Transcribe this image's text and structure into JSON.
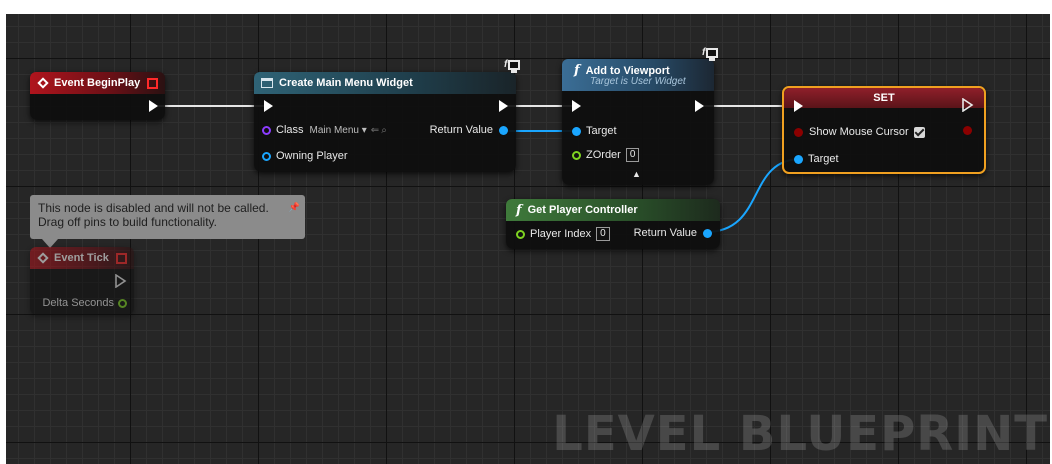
{
  "graph": {
    "watermark": "LEVEL BLUEPRINT"
  },
  "event_beginplay": {
    "title": "Event BeginPlay"
  },
  "create_widget": {
    "title": "Create Main Menu Widget",
    "class_label": "Class",
    "class_value": "Main Menu",
    "owning_player_label": "Owning Player",
    "return_value_label": "Return Value"
  },
  "add_to_viewport": {
    "title": "Add to Viewport",
    "subtitle": "Target is User Widget",
    "target_label": "Target",
    "zorder_label": "ZOrder",
    "zorder_value": "0"
  },
  "set_node": {
    "title": "SET",
    "show_mouse_cursor_label": "Show Mouse Cursor",
    "target_label": "Target"
  },
  "get_player_controller": {
    "title": "Get Player Controller",
    "player_index_label": "Player Index",
    "player_index_value": "0",
    "return_value_label": "Return Value"
  },
  "comment": {
    "line1": "This node is disabled and will not be called.",
    "line2": "Drag off pins to build functionality."
  },
  "event_tick": {
    "title": "Event Tick",
    "delta_seconds_label": "Delta Seconds"
  },
  "colors": {
    "graph_bg": "#262626",
    "object_pin": "#1aa6ff",
    "float_pin": "#7ed321",
    "selection": "#f0a020"
  }
}
